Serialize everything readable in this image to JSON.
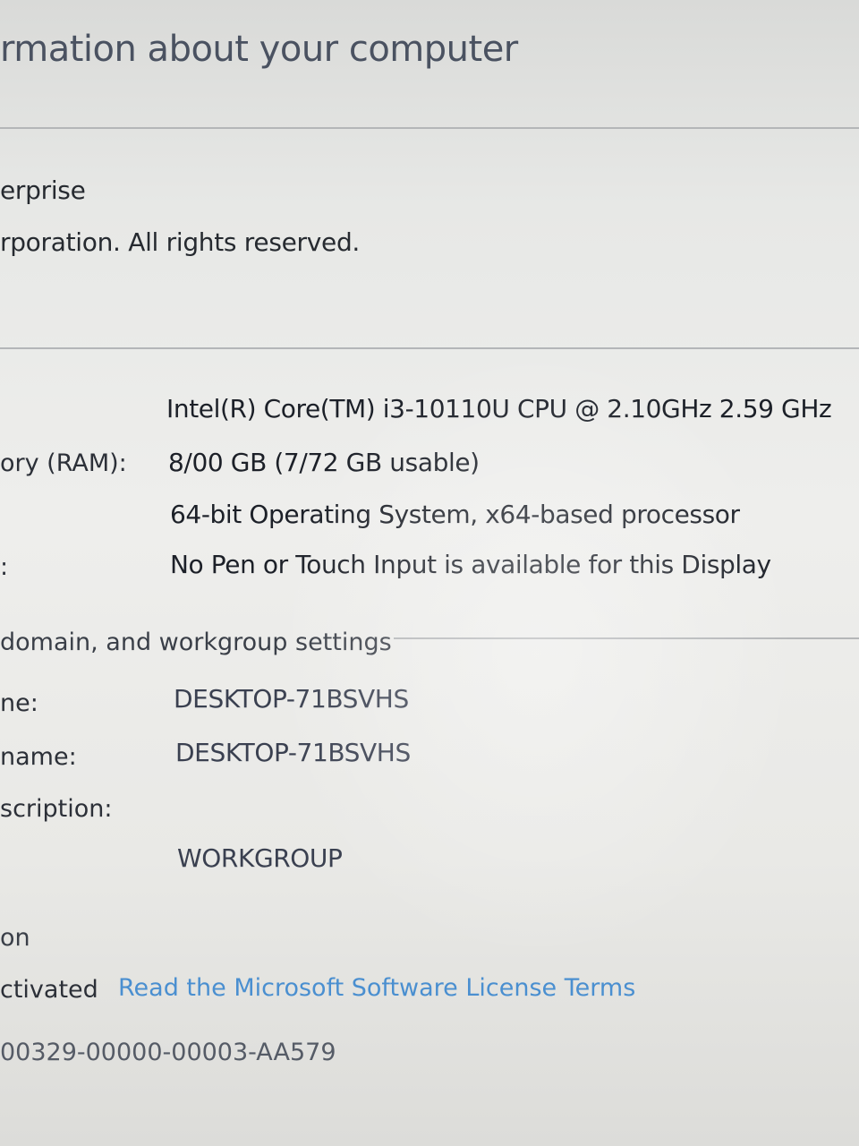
{
  "page": {
    "title": "rmation about your computer"
  },
  "edition": {
    "name": "erprise",
    "copyright": "rporation. All rights reserved."
  },
  "system": {
    "processor_value": "Intel(R) Core(TM) i3-10110U CPU @ 2.10GHz   2.59 GHz",
    "ram_label": "ory (RAM):",
    "ram_value": "8/00 GB (7/72 GB usable)",
    "type_value": "64-bit Operating System, x64-based processor",
    "pen_label": ":",
    "pen_value": "No Pen or Touch Input is available for this Display"
  },
  "computer_name_section": {
    "heading": "domain, and workgroup settings",
    "computer_name_label": "ne:",
    "computer_name_value": "DESKTOP-71BSVHS",
    "full_name_label": " name:",
    "full_name_value": "DESKTOP-71BSVHS",
    "description_label": "scription:",
    "workgroup_value": "WORKGROUP"
  },
  "activation": {
    "heading": "on",
    "status": "ctivated",
    "license_link": "Read the Microsoft Software License Terms",
    "product_id": "00329-00000-00003-AA579"
  },
  "colors": {
    "link": "#4a8fd0",
    "separator": "#b4b6b8"
  }
}
